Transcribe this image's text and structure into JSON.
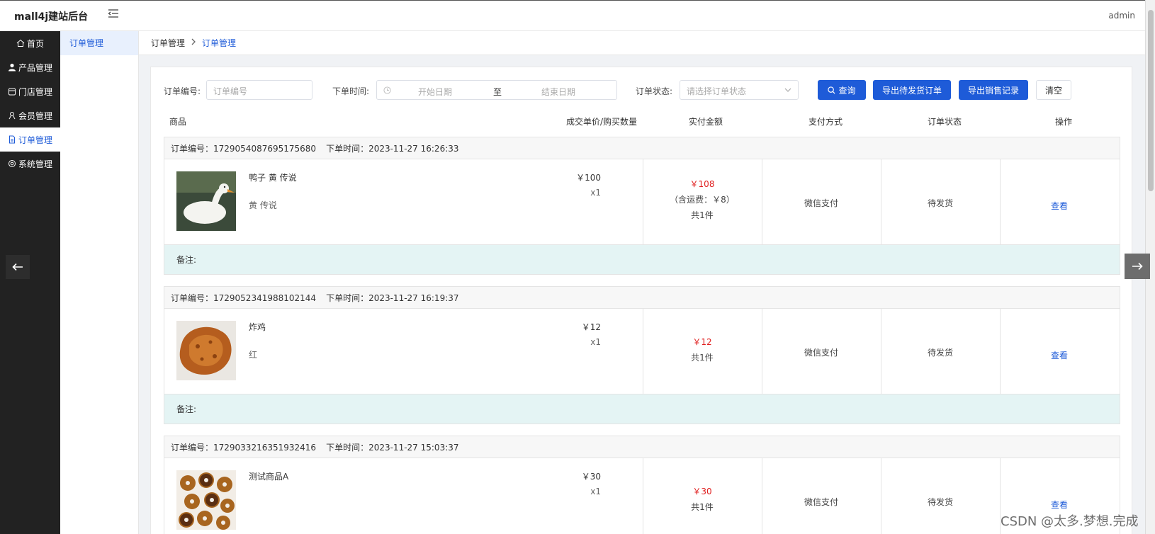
{
  "header": {
    "logo": "mall4j建站后台",
    "user": "admin"
  },
  "sidenav": [
    {
      "label": "首页",
      "icon": "home-icon"
    },
    {
      "label": "产品管理",
      "icon": "user-icon"
    },
    {
      "label": "门店管理",
      "icon": "store-icon"
    },
    {
      "label": "会员管理",
      "icon": "members-icon"
    },
    {
      "label": "订单管理",
      "icon": "document-icon",
      "active": true
    },
    {
      "label": "系统管理",
      "icon": "gear-icon"
    }
  ],
  "submenu": {
    "item": "订单管理"
  },
  "breadcrumb": {
    "parent": "订单管理",
    "current": "订单管理"
  },
  "filter": {
    "order_no_label": "订单编号:",
    "order_no_placeholder": "订单编号",
    "time_label": "下单时间:",
    "start_placeholder": "开始日期",
    "range_sep": "至",
    "end_placeholder": "结束日期",
    "status_label": "订单状态:",
    "status_placeholder": "请选择订单状态",
    "query_btn": "查询",
    "export_pending_btn": "导出待发货订单",
    "export_sales_btn": "导出销售记录",
    "clear_btn": "清空"
  },
  "table_headers": {
    "product": "商品",
    "price_qty": "成交单价/购买数量",
    "paid": "实付金额",
    "pay_method": "支付方式",
    "status": "订单状态",
    "action": "操作"
  },
  "orders": [
    {
      "no_label": "订单编号：1729054087695175680",
      "time_label": "下单时间：2023-11-27 16:26:33",
      "name": "鸭子 黄 传说",
      "sku": "黄 传说",
      "price": "￥100",
      "qty": "x1",
      "amount": "￥108",
      "freight": "（含运费：￥8）",
      "count": "共1件",
      "pay": "微信支付",
      "status": "待发货",
      "action": "查看",
      "remark": "备注:"
    },
    {
      "no_label": "订单编号：1729052341988102144",
      "time_label": "下单时间：2023-11-27 16:19:37",
      "name": "炸鸡",
      "sku": "红",
      "price": "￥12",
      "qty": "x1",
      "amount": "￥12",
      "count": "共1件",
      "pay": "微信支付",
      "status": "待发货",
      "action": "查看",
      "remark": "备注:"
    },
    {
      "no_label": "订单编号：1729033216351932416",
      "time_label": "下单时间：2023-11-27 15:03:37",
      "name": "测试商品A",
      "price": "￥30",
      "qty": "x1",
      "amount": "￥30",
      "count": "共1件",
      "pay": "微信支付",
      "status": "待发货",
      "action": "查看"
    }
  ],
  "watermark": "CSDN @太多.梦想.完成",
  "colors": {
    "primary": "#1e5bd8",
    "price_red": "#e02020",
    "sidebar": "#222222",
    "remark_bg": "#e4f4f4"
  }
}
